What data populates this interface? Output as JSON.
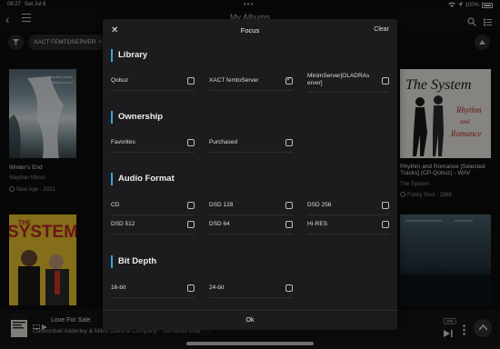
{
  "status": {
    "time": "08:27",
    "date": "Sat Jul 6",
    "battery": "100%"
  },
  "header": {
    "title": "My Albums"
  },
  "filter": {
    "chip": "XACT FEMTOSERVER",
    "chip_close": "×"
  },
  "albums": [
    {
      "title": "Winter's End",
      "artist": "Stephan Micus",
      "genre": "New Age · 2021",
      "art_title": "Stephan Micus",
      "art_subtitle": "Winter's End"
    },
    {
      "title": "Rhythm and Romance [Selected Tracks] (CP-Qobuz) - WAV",
      "title_line1": "Rhythm and Romance [Selected",
      "title_line2": "Tracks] (CP-Qobuz) - WAV",
      "artist": "The System",
      "genre": "Funky Soul · 1989"
    },
    {
      "title": "The System"
    },
    {
      "title": "Night album"
    }
  ],
  "player": {
    "title": "Love For Sale",
    "subtitle": "Cannonball Adderley & Miles Davis & Company - Somethin Else - ...",
    "badge": "395"
  },
  "modal": {
    "close": "✕",
    "title": "Focus",
    "clear": "Clear",
    "ok": "Ok",
    "sections": {
      "library": {
        "title": "Library",
        "options": [
          {
            "label": "Qobuz",
            "checked": false
          },
          {
            "label": "XACT femtoServer",
            "checked": true
          },
          {
            "label": "MinimServer[OLADRAs erver]",
            "label_line1": "MinimServer[OLADRAs",
            "label_line2": "erver]",
            "checked": false
          }
        ]
      },
      "ownership": {
        "title": "Ownership",
        "options": [
          {
            "label": "Favorites",
            "checked": false
          },
          {
            "label": "Purchased",
            "checked": false
          }
        ]
      },
      "format": {
        "title": "Audio Format",
        "options": [
          {
            "label": "CD",
            "checked": false
          },
          {
            "label": "DSD 128",
            "checked": false
          },
          {
            "label": "DSD 256",
            "checked": false
          },
          {
            "label": "DSD 512",
            "checked": false
          },
          {
            "label": "DSD 64",
            "checked": false
          },
          {
            "label": "HI-RES",
            "checked": false
          }
        ]
      },
      "bitdepth": {
        "title": "Bit Depth",
        "options": [
          {
            "label": "16-bit",
            "checked": false
          },
          {
            "label": "24-bit",
            "checked": false
          }
        ]
      }
    }
  },
  "colors": {
    "accent": "#3ba6d9",
    "modal_bg": "#1c1c1e",
    "app_bg": "#0d0d0d"
  }
}
